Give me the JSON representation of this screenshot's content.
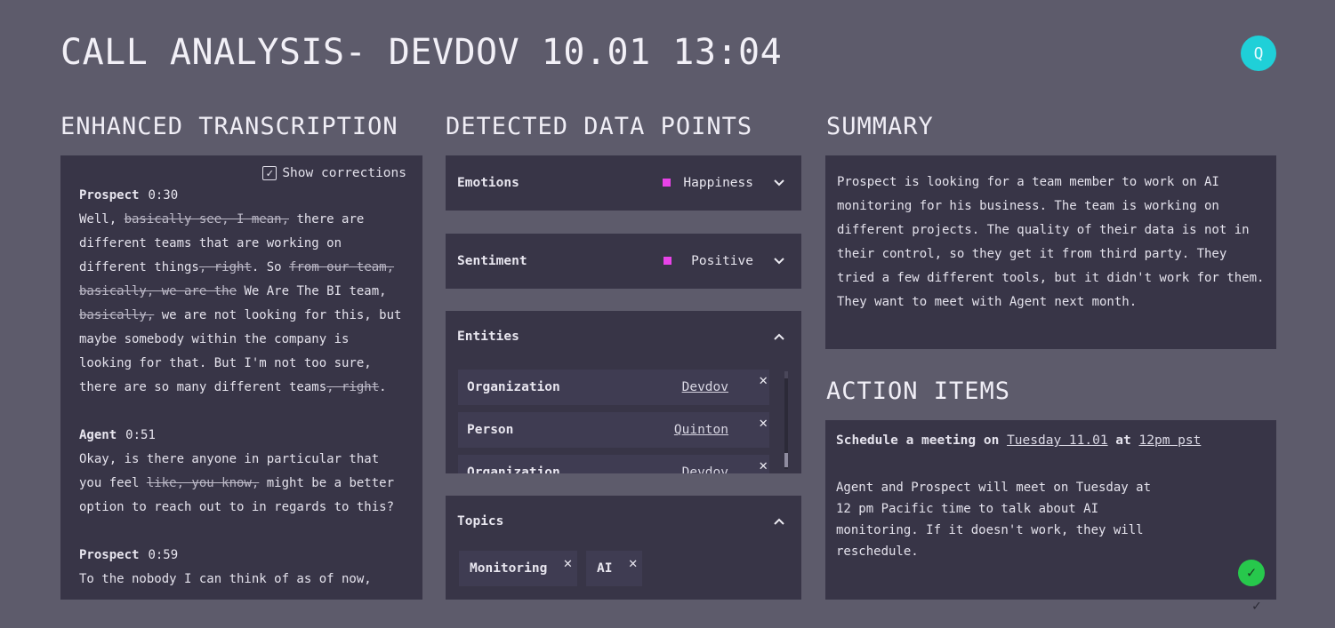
{
  "header": {
    "title": "CALL ANALYSIS- DEVDOV 10.01 13:04",
    "avatar_initial": "Q"
  },
  "transcription": {
    "title": "ENHANCED TRANSCRIPTION",
    "show_corrections_label": "Show corrections",
    "show_corrections_checked": true,
    "blocks": [
      {
        "speaker": "Prospect",
        "time": "0:30",
        "parts": [
          {
            "t": "Well, "
          },
          {
            "t": "basically see, I mean,",
            "s": true
          },
          {
            "t": " there are different teams that are working on different things"
          },
          {
            "t": ", right",
            "s": true
          },
          {
            "t": ". So "
          },
          {
            "t": "from our team, basically, we are the",
            "s": true
          },
          {
            "t": " We Are The BI team, "
          },
          {
            "t": "basically,",
            "s": true
          },
          {
            "t": " we are not looking for this, but maybe somebody within the company is looking for that. But I'm not too sure, there are so many different teams"
          },
          {
            "t": ", right",
            "s": true
          },
          {
            "t": "."
          }
        ]
      },
      {
        "speaker": "Agent",
        "time": "0:51",
        "parts": [
          {
            "t": "Okay, is there anyone in particular that you feel "
          },
          {
            "t": "like, you know,",
            "s": true
          },
          {
            "t": " might be a better option to reach out to in regards to this?"
          }
        ]
      },
      {
        "speaker": "Prospect",
        "time": "0:59",
        "parts": [
          {
            "t": "To the nobody I can think of as of now,"
          }
        ]
      }
    ]
  },
  "data_points": {
    "title": "DETECTED DATA POINTS",
    "emotions": {
      "label": "Emotions",
      "value": "Happiness",
      "color": "#e843e8"
    },
    "sentiment": {
      "label": "Sentiment",
      "value": "Positive",
      "color": "#e843e8"
    },
    "entities": {
      "label": "Entities",
      "items": [
        {
          "type": "Organization",
          "value": "Devdov"
        },
        {
          "type": "Person",
          "value": "Quinton"
        },
        {
          "type": "Organization",
          "value": "Devdov"
        }
      ]
    },
    "topics": {
      "label": "Topics",
      "items": [
        "Monitoring",
        "AI"
      ]
    }
  },
  "summary": {
    "title": "SUMMARY",
    "text": "Prospect is looking for a team member to work on AI monitoring for his business. The team is working on different projects. The quality of their data is not in their control, so they get it from third party. They tried a few different tools, but it didn't work for them. They want to meet with Agent next month."
  },
  "action_items": {
    "title": "ACTION ITEMS",
    "head_prefix": "Schedule a meeting on",
    "date": "Tuesday 11.01",
    "at": "at",
    "time": "12pm pst",
    "description": "Agent and Prospect will meet on Tuesday at 12 pm Pacific time to talk about AI monitoring. If it doesn't work, they will reschedule.",
    "done_color": "#27c84c"
  },
  "icons": {
    "chevron_down": "⌄",
    "chevron_up": "⌃",
    "close": "✕",
    "check": "✓"
  }
}
